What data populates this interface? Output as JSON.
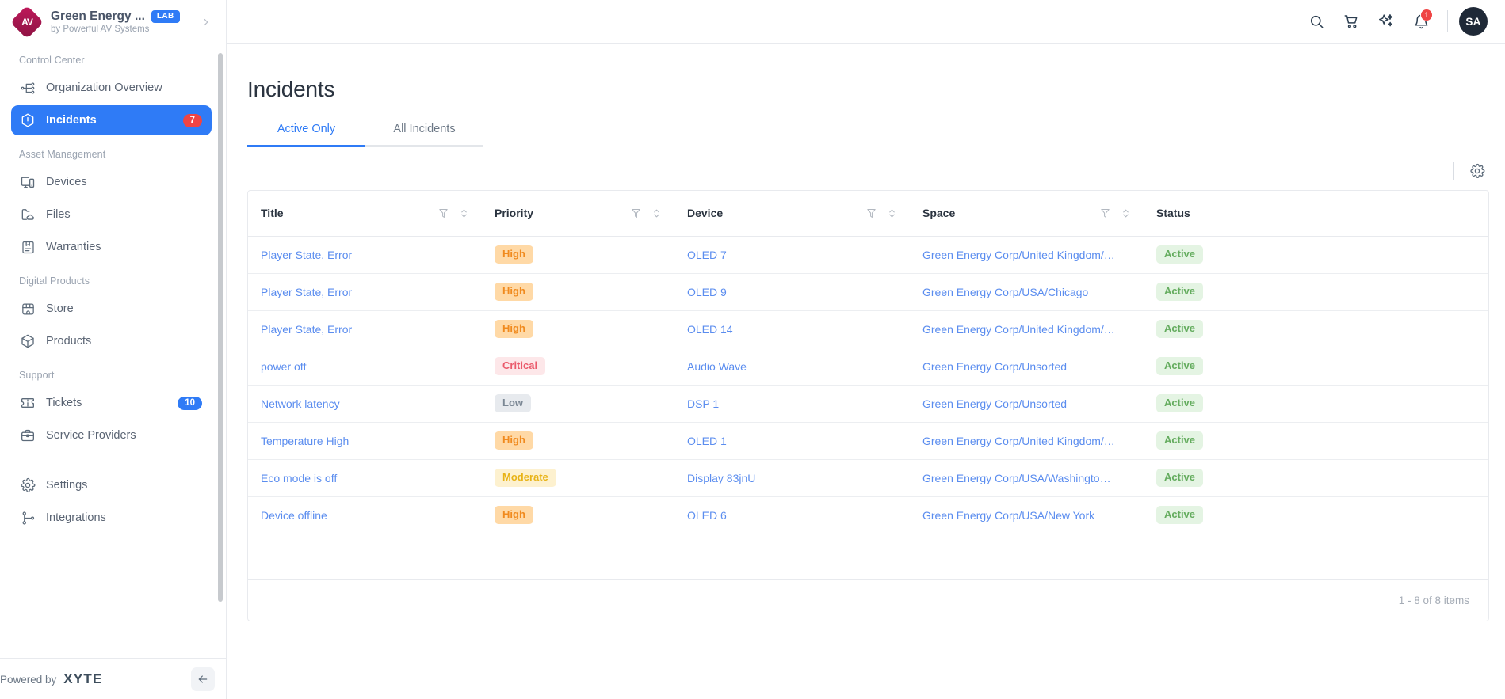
{
  "sidebar": {
    "brand": {
      "name": "Green Energy ...",
      "badge": "LAB",
      "subtitle": "by Powerful AV Systems",
      "logo_text": "AV",
      "chevron_icon": "chevron-right-icon"
    },
    "sections": [
      {
        "label": "Control Center",
        "items": [
          {
            "label": "Organization Overview",
            "icon": "org-tree-icon",
            "active": false,
            "badge": null
          },
          {
            "label": "Incidents",
            "icon": "incident-hexagon-icon",
            "active": true,
            "badge": "7",
            "badge_color": "red"
          }
        ]
      },
      {
        "label": "Asset Management",
        "items": [
          {
            "label": "Devices",
            "icon": "devices-icon",
            "active": false,
            "badge": null
          },
          {
            "label": "Files",
            "icon": "files-cloud-icon",
            "active": false,
            "badge": null
          },
          {
            "label": "Warranties",
            "icon": "warranty-bookmark-icon",
            "active": false,
            "badge": null
          }
        ]
      },
      {
        "label": "Digital Products",
        "items": [
          {
            "label": "Store",
            "icon": "store-icon",
            "active": false,
            "badge": null
          },
          {
            "label": "Products",
            "icon": "product-box-icon",
            "active": false,
            "badge": null
          }
        ]
      },
      {
        "label": "Support",
        "items": [
          {
            "label": "Tickets",
            "icon": "ticket-icon",
            "active": false,
            "badge": "10",
            "badge_color": "blue"
          },
          {
            "label": "Service Providers",
            "icon": "briefcase-icon",
            "active": false,
            "badge": null
          }
        ]
      },
      {
        "label": "",
        "items": [
          {
            "label": "Settings",
            "icon": "gear-icon",
            "active": false,
            "badge": null
          },
          {
            "label": "Integrations",
            "icon": "integrations-icon",
            "active": false,
            "badge": null
          }
        ]
      }
    ],
    "footer": {
      "powered_by": "Powered by",
      "vendor": "XYTE",
      "collapse_icon": "arrow-left-icon"
    }
  },
  "topbar": {
    "icons": [
      {
        "name": "search-icon"
      },
      {
        "name": "cart-icon"
      },
      {
        "name": "sparkles-ai-icon"
      },
      {
        "name": "bell-icon",
        "badge": "1"
      }
    ],
    "avatar_initials": "SA"
  },
  "page": {
    "title": "Incidents",
    "tabs": [
      {
        "label": "Active Only",
        "active": true
      },
      {
        "label": "All Incidents",
        "active": false
      }
    ],
    "toolbar": {
      "settings_icon": "gear-icon"
    }
  },
  "table": {
    "columns": [
      {
        "label": "Title",
        "filterable": true,
        "sortable": true
      },
      {
        "label": "Priority",
        "filterable": true,
        "sortable": true
      },
      {
        "label": "Device",
        "filterable": true,
        "sortable": true
      },
      {
        "label": "Space",
        "filterable": true,
        "sortable": true
      },
      {
        "label": "Status",
        "filterable": false,
        "sortable": false
      }
    ],
    "rows": [
      {
        "title": "Player State, Error",
        "priority": "High",
        "priority_class": "bg-high",
        "device": "OLED 7",
        "space": "Green Energy Corp/United Kingdom/London",
        "status": "Active"
      },
      {
        "title": "Player State, Error",
        "priority": "High",
        "priority_class": "bg-high",
        "device": "OLED 9",
        "space": "Green Energy Corp/USA/Chicago",
        "status": "Active"
      },
      {
        "title": "Player State, Error",
        "priority": "High",
        "priority_class": "bg-high",
        "device": "OLED 14",
        "space": "Green Energy Corp/United Kingdom/Manch...",
        "status": "Active"
      },
      {
        "title": "power off",
        "priority": "Critical",
        "priority_class": "bg-critical",
        "device": "Audio Wave",
        "space": "Green Energy Corp/Unsorted",
        "status": "Active"
      },
      {
        "title": "Network latency",
        "priority": "Low",
        "priority_class": "bg-low",
        "device": "DSP 1",
        "space": "Green Energy Corp/Unsorted",
        "status": "Active"
      },
      {
        "title": "Temperature High",
        "priority": "High",
        "priority_class": "bg-high",
        "device": "OLED 1",
        "space": "Green Energy Corp/United Kingdom/Manch...",
        "status": "Active"
      },
      {
        "title": "Eco mode is off",
        "priority": "Moderate",
        "priority_class": "bg-moderate",
        "device": "Display 83jnU",
        "space": "Green Energy Corp/USA/Washington DC",
        "status": "Active"
      },
      {
        "title": "Device offline",
        "priority": "High",
        "priority_class": "bg-high",
        "device": "OLED 6",
        "space": "Green Energy Corp/USA/New York",
        "status": "Active"
      }
    ],
    "pagination": "1 - 8 of 8 items"
  },
  "colors": {
    "accent": "#2f7bf6",
    "link": "#5b8def",
    "danger": "#ef4444",
    "high": "#f08a1e",
    "critical": "#ea5a6b",
    "low": "#7b8794",
    "moderate": "#e8b317",
    "active_status": "#64ac5e",
    "logo": "#a4174f"
  }
}
